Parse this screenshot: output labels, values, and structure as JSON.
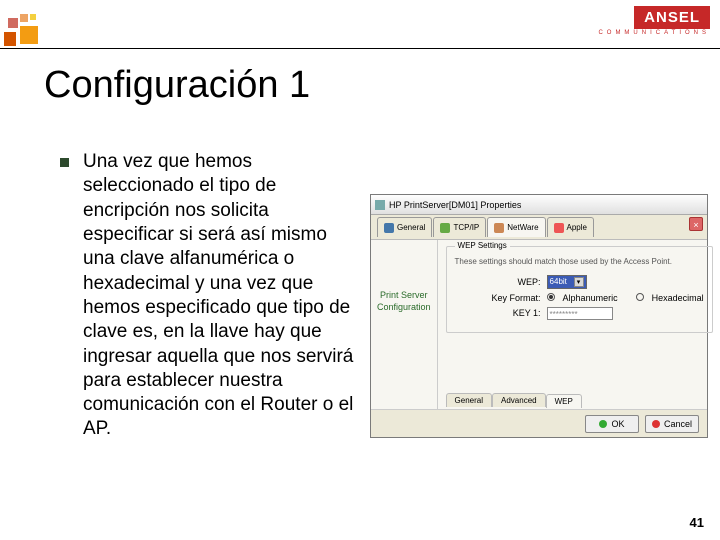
{
  "brand": {
    "name": "ANSEL",
    "subtitle": "COMMUNICATIONS"
  },
  "title": "Configuración 1",
  "bullet": "Una vez que hemos seleccionado el tipo de encripción nos solicita especificar si será así mismo una clave alfanumérica o hexadecimal y una vez que hemos especificado que tipo de clave es, en la llave hay que ingresar aquella que nos servirá para establecer nuestra comunicación con el Router o el AP.",
  "dialog": {
    "title": "HP PrintServer[DM01] Properties",
    "tabs": [
      "General",
      "TCP/IP",
      "NetWare",
      "Apple"
    ],
    "sidebar": "Print Server Configuration",
    "group": "WEP Settings",
    "hint": "These settings should match those used by the Access Point.",
    "fields": {
      "wep": "WEP:",
      "keyformat": "Key Format:",
      "key1": "KEY 1:"
    },
    "values": {
      "wep": "64bit",
      "radio1": "Alphanumeric",
      "radio2": "Hexadecimal",
      "key1": "*********"
    },
    "subtabs": [
      "General",
      "Advanced",
      "WEP"
    ],
    "buttons": {
      "ok": "OK",
      "cancel": "Cancel"
    }
  },
  "page": "41"
}
